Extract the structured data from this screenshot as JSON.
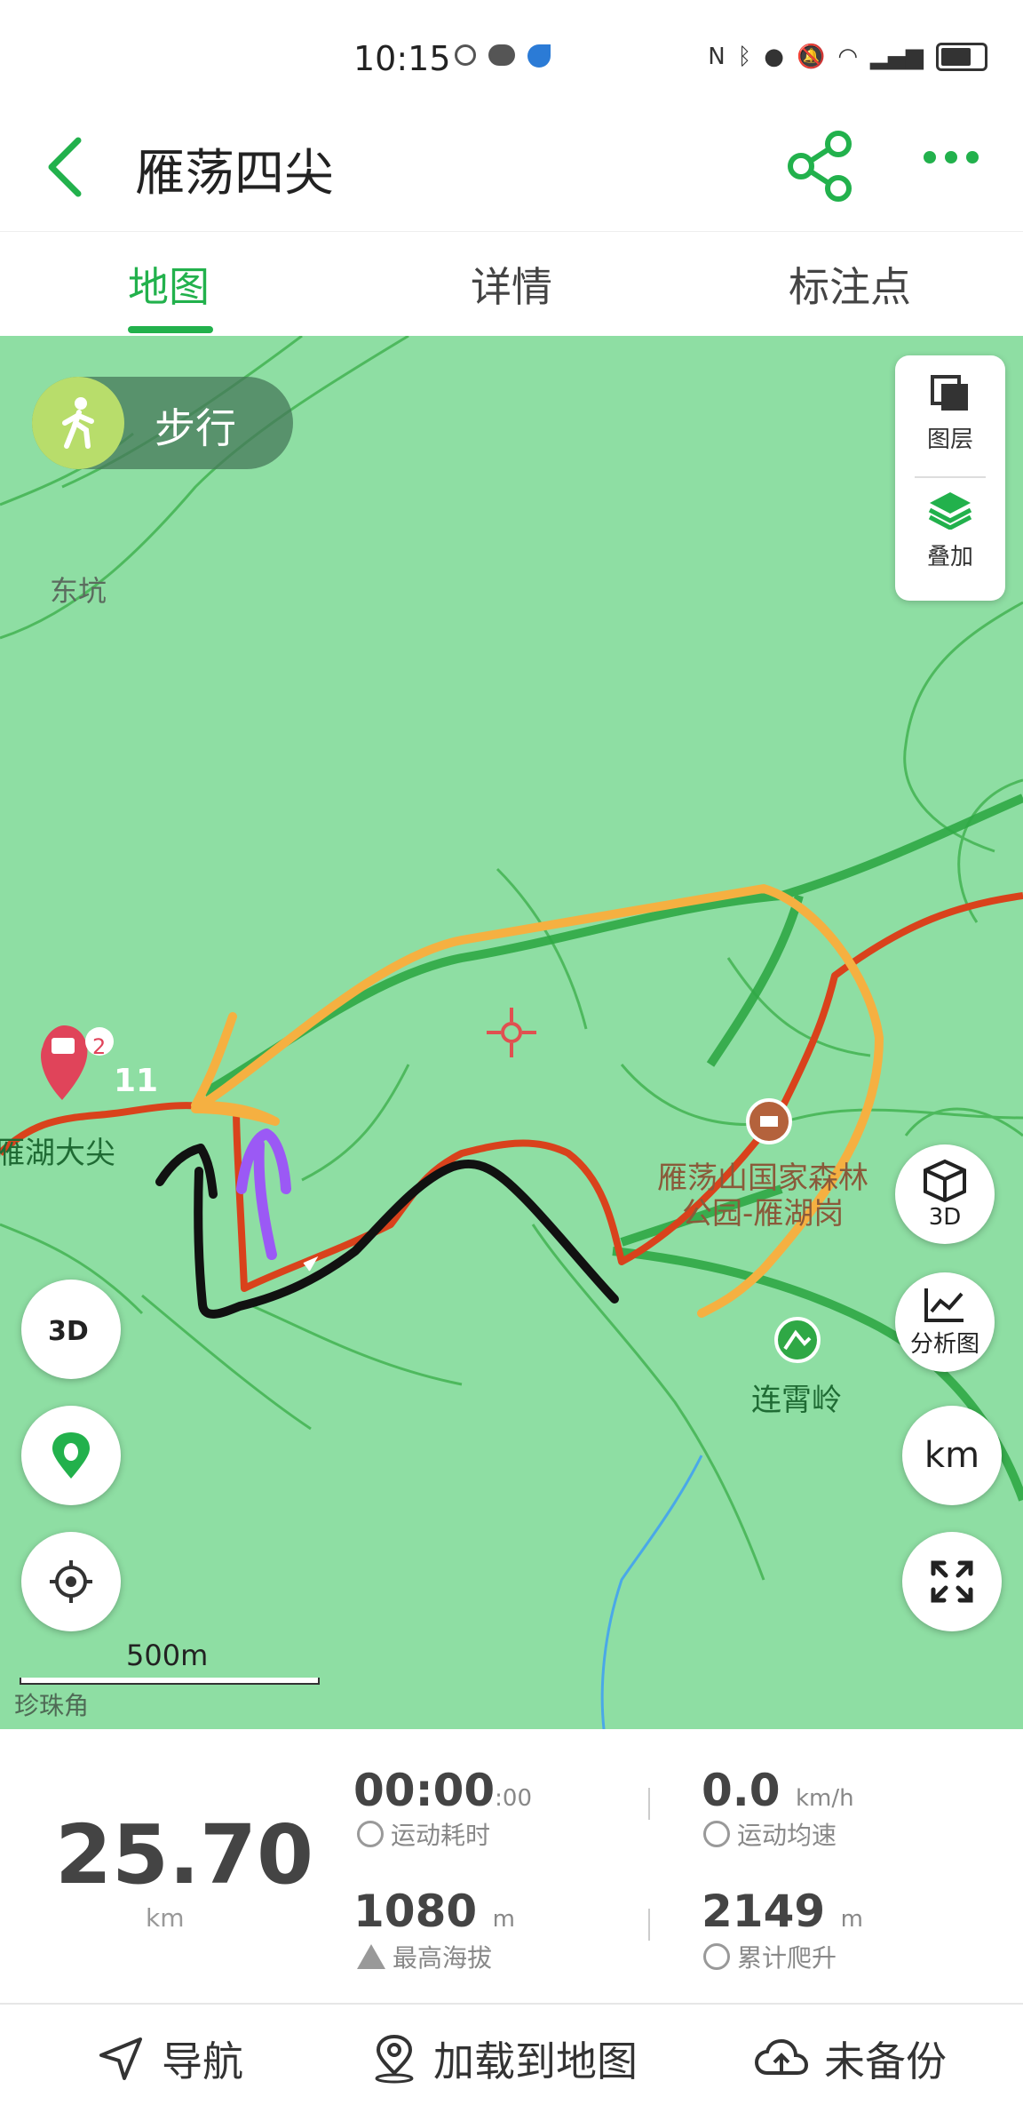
{
  "status_bar": {
    "time": "10:15",
    "battery_level": 0.75
  },
  "header": {
    "title": "雁荡四尖"
  },
  "tabs": [
    {
      "label": "地图",
      "active": true
    },
    {
      "label": "详情",
      "active": false
    },
    {
      "label": "标注点",
      "active": false
    }
  ],
  "map": {
    "mode": {
      "label": "步行"
    },
    "layer_panel": {
      "layers_label": "图层",
      "overlay_label": "叠加"
    },
    "places": {
      "dongkeng": "东坑",
      "yanhu_dajian": "雁湖大尖",
      "forest_park_line1": "雁荡山国家森林",
      "forest_park_line2": "公园-雁湖岗",
      "lianxiao_ling": "连霄岭",
      "bottom_place": "珍珠角"
    },
    "marker": {
      "badge": "2",
      "waypoint_number": "11"
    },
    "buttons": {
      "threed_label": "3D",
      "analysis_label": "分析图",
      "km_label": "km"
    },
    "scale_label": "500m"
  },
  "stats": {
    "distance": "25.70",
    "distance_unit": "km",
    "duration": "00:00",
    "duration_sub": ":00",
    "duration_label": "运动耗时",
    "speed": "0.0",
    "speed_unit": "km/h",
    "speed_label": "运动均速",
    "max_altitude": "1080",
    "max_altitude_unit": "m",
    "max_altitude_label": "最高海拔",
    "climb": "2149",
    "climb_unit": "m",
    "climb_label": "累计爬升"
  },
  "bottom_bar": {
    "navigate": "导航",
    "load_to_map": "加载到地图",
    "backup": "未备份"
  },
  "colors": {
    "accent": "#22b14c",
    "map_bg": "#8edea3",
    "route": "#d9421c",
    "annotation_orange": "#f5b041",
    "annotation_purple": "#9b59f5",
    "annotation_black": "#111111"
  }
}
